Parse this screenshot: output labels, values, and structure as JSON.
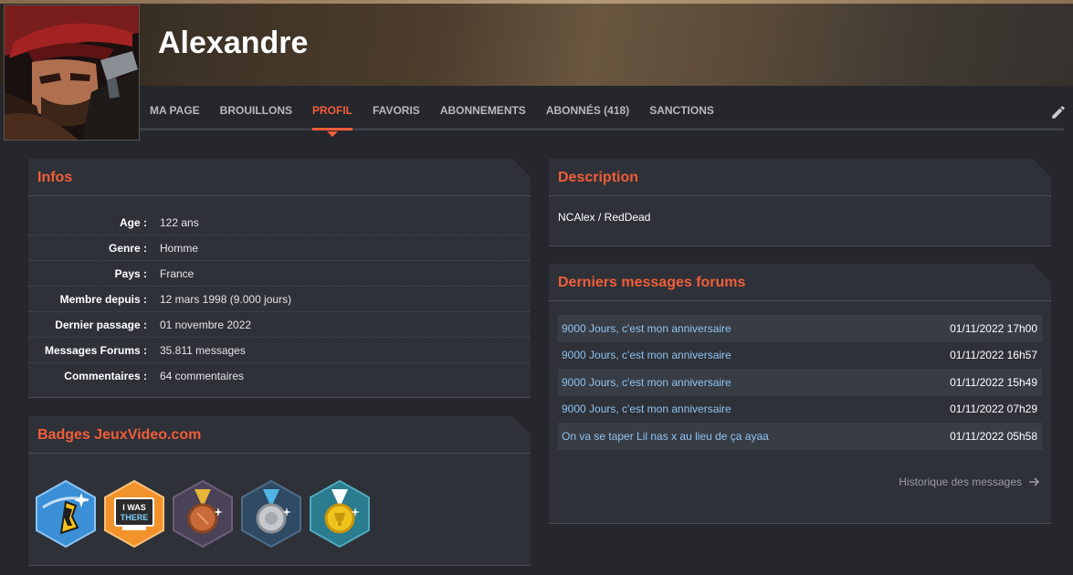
{
  "profile": {
    "name": "Alexandre"
  },
  "nav": {
    "tabs": [
      {
        "label": "MA PAGE"
      },
      {
        "label": "BROUILLONS"
      },
      {
        "label": "PROFIL"
      },
      {
        "label": "FAVORIS"
      },
      {
        "label": "ABONNEMENTS"
      },
      {
        "label": "ABONNÉS (418)"
      },
      {
        "label": "SANCTIONS"
      }
    ],
    "active": "PROFIL",
    "edit_icon": "pencil-icon"
  },
  "infos": {
    "title": "Infos",
    "rows": [
      {
        "label": "Age :",
        "value": "122 ans"
      },
      {
        "label": "Genre :",
        "value": "Homme"
      },
      {
        "label": "Pays :",
        "value": "France"
      },
      {
        "label": "Membre depuis :",
        "value": "12 mars 1998 (9.000 jours)"
      },
      {
        "label": "Dernier passage :",
        "value": "01 novembre 2022"
      },
      {
        "label": "Messages Forums :",
        "value": "35.811 messages"
      },
      {
        "label": "Commentaires :",
        "value": "64 commentaires"
      }
    ]
  },
  "badges": {
    "title": "Badges JeuxVideo.com",
    "items": [
      {
        "icon": "rocket-badge-icon"
      },
      {
        "icon": "i-was-there-badge-icon",
        "text": [
          "I WAS",
          "THERE"
        ]
      },
      {
        "icon": "bronze-medal-badge-icon"
      },
      {
        "icon": "silver-medal-badge-icon"
      },
      {
        "icon": "gold-trophy-badge-icon"
      }
    ]
  },
  "description": {
    "title": "Description",
    "text": "NCAlex / RedDead"
  },
  "forum_messages": {
    "title": "Derniers messages forums",
    "items": [
      {
        "subject": "9000 Jours, c'est mon anniversaire",
        "date": "01/11/2022 17h00"
      },
      {
        "subject": "9000 Jours, c'est mon anniversaire",
        "date": "01/11/2022 16h57"
      },
      {
        "subject": "9000 Jours, c'est mon anniversaire",
        "date": "01/11/2022 15h49"
      },
      {
        "subject": "9000 Jours, c'est mon anniversaire",
        "date": "01/11/2022 07h29"
      },
      {
        "subject": "On va se taper Lil nas x au lieu de ça ayaa",
        "date": "01/11/2022 05h58"
      }
    ],
    "history_label": "Historique des messages"
  },
  "colors": {
    "accent": "#f15d39",
    "link": "#8fc3f0",
    "panel": "#2e3138",
    "background": "#25272c"
  }
}
